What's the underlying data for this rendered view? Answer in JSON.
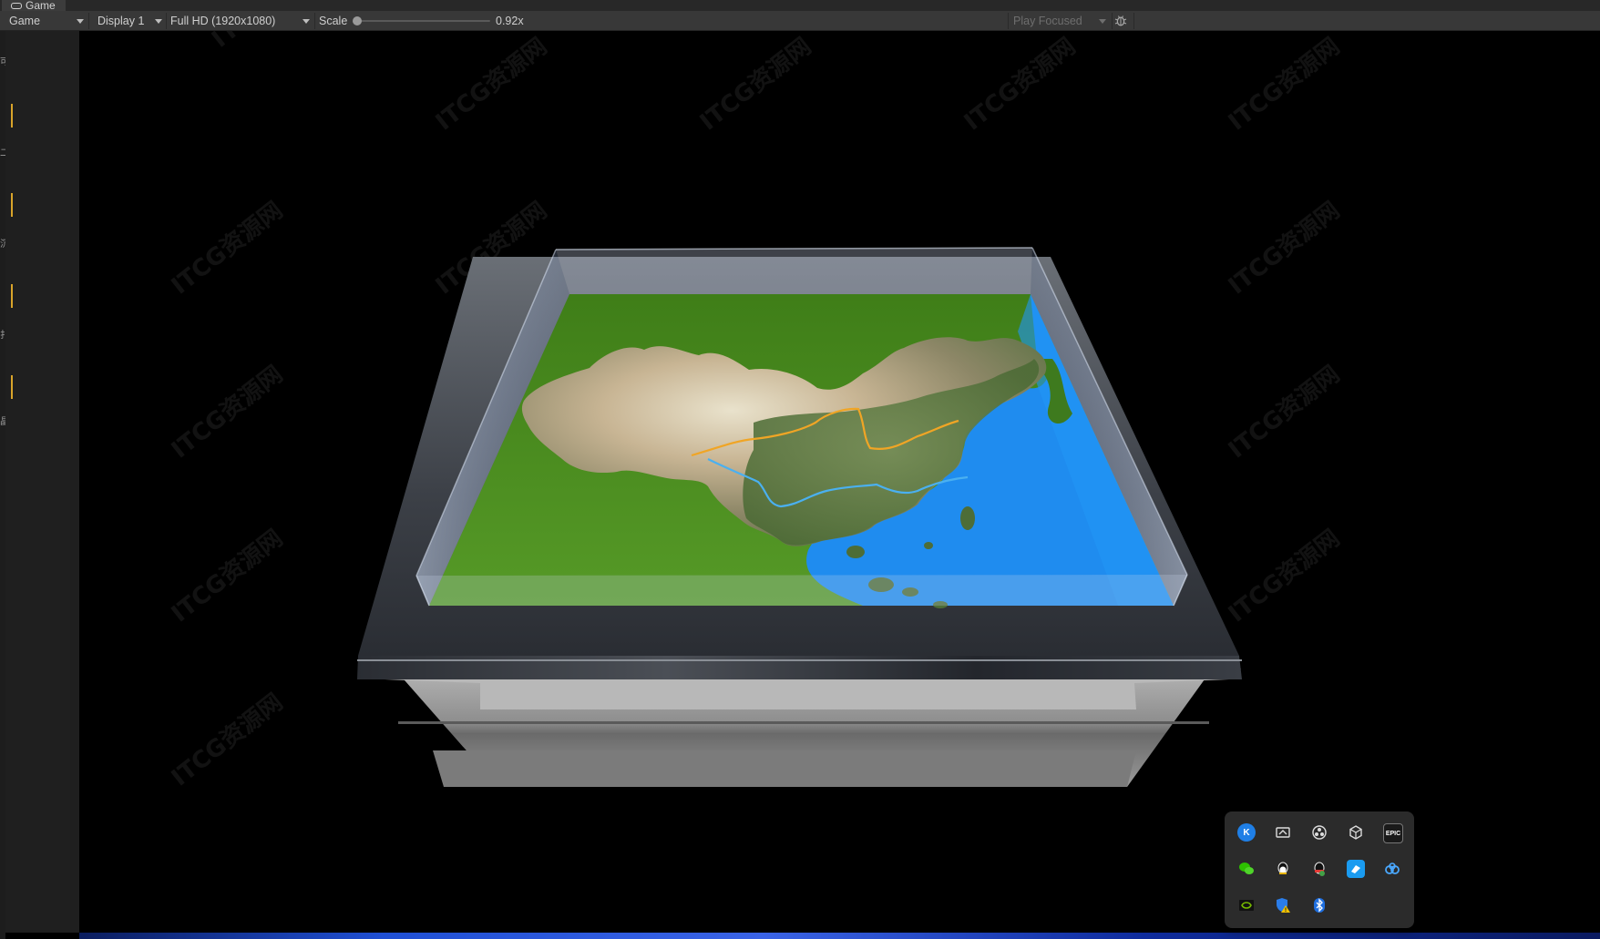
{
  "tab": {
    "label": "Game",
    "icon": "gamepad-icon"
  },
  "toolbar": {
    "view_select": "Game",
    "display_select": "Display 1",
    "resolution_select": "Full HD (1920x1080)",
    "scale_label": "Scale",
    "scale_value": "0.92x",
    "scale_level": 0.0,
    "play_mode_select": "Play Focused",
    "debug_icon": "bug-icon"
  },
  "left_panel": {
    "glyphs": [
      "可",
      "二",
      "沉",
      "扌",
      "晶"
    ]
  },
  "viewport": {
    "watermark": "ITCG资源网",
    "scene": "3D relief map of China inside a glass-walled display box",
    "colors": {
      "ground": "#4a8a1f",
      "sea": "#1e8cf0",
      "frame": "#4e5258",
      "base": "#8e8e8e"
    }
  },
  "tray": {
    "icons": [
      "k-app-icon",
      "remote-desktop-icon",
      "obs-icon",
      "unity-icon",
      "epic-games-icon",
      "wechat-icon",
      "qq-icon",
      "qq-alt-icon",
      "feishu-icon",
      "baidu-netdisk-icon",
      "nvidia-icon",
      "security-warning-icon",
      "bluetooth-icon"
    ],
    "labels": {
      "epic": "EPIC",
      "k": "K"
    }
  }
}
